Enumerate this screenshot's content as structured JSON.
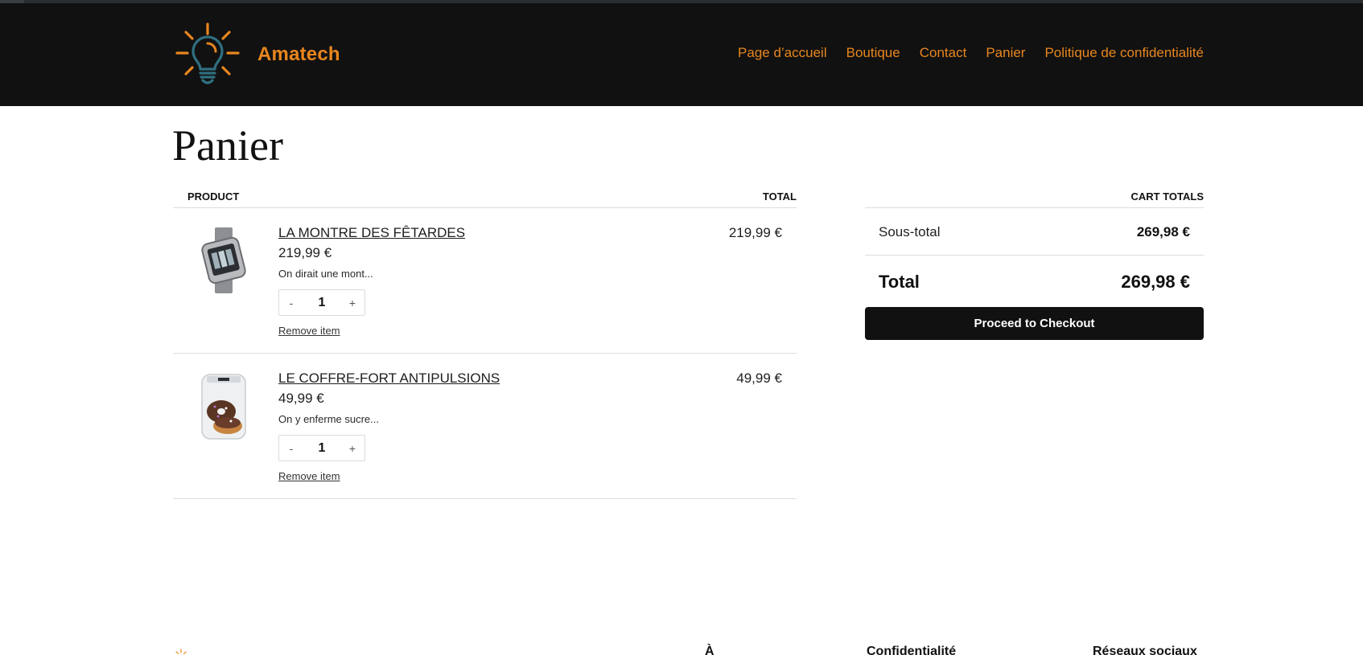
{
  "site": {
    "title": "Amatech",
    "brand_color": "#e8861e",
    "header_bg": "#111111",
    "logo_icon": "lightbulb-icon"
  },
  "nav": {
    "items": [
      {
        "label": "Page d’accueil"
      },
      {
        "label": "Boutique"
      },
      {
        "label": "Contact"
      },
      {
        "label": "Panier"
      },
      {
        "label": "Politique de confidentialité"
      }
    ]
  },
  "page": {
    "title": "Panier"
  },
  "cart": {
    "headers": {
      "product": "Product",
      "total": "Total"
    },
    "items": [
      {
        "name": "La montre des fêtardes",
        "price": "219,99 €",
        "description": "On dirait une mont...",
        "quantity": "1",
        "minus": "-",
        "plus": "+",
        "remove_label": "Remove item",
        "line_total": "219,99 €",
        "image_icon": "smartwatch-image"
      },
      {
        "name": "Le coffre-fort antipulsions",
        "price": "49,99 €",
        "description": "On y enferme sucre...",
        "quantity": "1",
        "minus": "-",
        "plus": "+",
        "remove_label": "Remove item",
        "line_total": "49,99 €",
        "image_icon": "donut-jar-image"
      }
    ]
  },
  "totals": {
    "heading": "Cart totals",
    "subtotal_label": "Sous-total",
    "subtotal_value": "269,98 €",
    "total_label": "Total",
    "total_value": "269,98 €",
    "checkout_label": "Proceed to Checkout"
  },
  "footer": {
    "col1": "À",
    "col2": "Confidentialité",
    "col3": "Réseaux sociaux"
  }
}
